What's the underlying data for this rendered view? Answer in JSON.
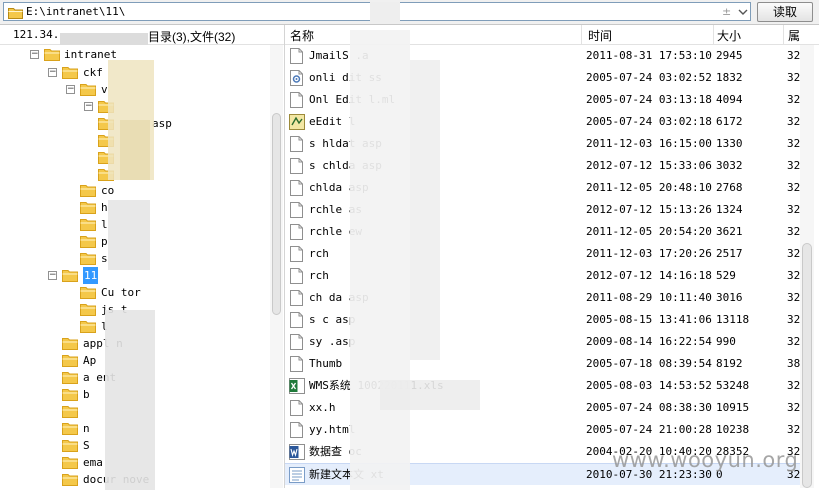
{
  "toolbar": {
    "path_value": "E:\\intranet\\11\\",
    "read_button": "读取",
    "combo_icon": "down-chevron-icon"
  },
  "tree": {
    "ip_prefix": "121.34.",
    "counts": "目录(3),文件(32)",
    "items": [
      {
        "label": "intranet",
        "expanded": true
      },
      {
        "label": "ckf",
        "expanded": true
      },
      {
        "label": "v",
        "expanded": true
      },
      {
        "label": "",
        "expanded": true
      },
      {
        "label": "asp"
      },
      {
        "label": ""
      },
      {
        "label": ""
      },
      {
        "label": ""
      },
      {
        "label": "co"
      },
      {
        "label": "he"
      },
      {
        "label": "la"
      },
      {
        "label": "pl"
      },
      {
        "label": "sk"
      },
      {
        "label": "11",
        "expanded": true,
        "selected": true
      },
      {
        "label": "Cu        tor"
      },
      {
        "label": "js      t"
      },
      {
        "label": "l"
      },
      {
        "label": "appl      n"
      },
      {
        "label": "Ap"
      },
      {
        "label": "a        ent"
      },
      {
        "label": "b"
      },
      {
        "label": ""
      },
      {
        "label": "n"
      },
      {
        "label": "S"
      },
      {
        "label": "ema"
      },
      {
        "label": "docur    nove"
      }
    ]
  },
  "list": {
    "headers": {
      "name": "名称",
      "time": "时间",
      "size": "大小",
      "attr": "属"
    },
    "files": [
      {
        "name": "JmailS    .a",
        "icon": "file-icon",
        "time": "2011-08-31 17:53:10",
        "size": "2945",
        "attr": "32"
      },
      {
        "name": "onli  dit     ss",
        "icon": "gear-file-icon",
        "time": "2005-07-24 03:02:52",
        "size": "1832",
        "attr": "32"
      },
      {
        "name": "Onl   Edit    l.ml",
        "icon": "file-icon",
        "time": "2005-07-24 03:13:18",
        "size": "4094",
        "attr": "32"
      },
      {
        "name": "    eEdit    l",
        "icon": "script-file-icon",
        "time": "2005-07-24 03:02:18",
        "size": "6172",
        "attr": "32"
      },
      {
        "name": "s   hldat    asp",
        "icon": "file-icon",
        "time": "2011-12-03 16:15:00",
        "size": "1330",
        "attr": "32"
      },
      {
        "name": "s   chlda    asp",
        "icon": "file-icon",
        "time": "2012-07-12 15:33:06",
        "size": "3032",
        "attr": "32"
      },
      {
        "name": "    chlda    asp",
        "icon": "file-icon",
        "time": "2011-12-05 20:48:10",
        "size": "2768",
        "attr": "32"
      },
      {
        "name": "   rchle     as",
        "icon": "file-icon",
        "time": "2012-07-12 15:13:26",
        "size": "1324",
        "attr": "32"
      },
      {
        "name": "   rchle     ew",
        "icon": "file-icon",
        "time": "2011-12-05 20:54:20",
        "size": "3621",
        "attr": "32"
      },
      {
        "name": "   rch",
        "icon": "file-icon",
        "time": "2011-12-03 17:20:26",
        "size": "2517",
        "attr": "32"
      },
      {
        "name": "   rch",
        "icon": "file-icon",
        "time": "2012-07-12 14:16:18",
        "size": "529",
        "attr": "32"
      },
      {
        "name": "    ch       da  asp",
        "icon": "file-icon",
        "time": "2011-08-29 10:11:40",
        "size": "3016",
        "attr": "32"
      },
      {
        "name": "s   c        asp",
        "icon": "file-icon",
        "time": "2005-08-15 13:41:06",
        "size": "13118",
        "attr": "32"
      },
      {
        "name": "sy         .asp",
        "icon": "file-icon",
        "time": "2009-08-14 16:22:54",
        "size": "990",
        "attr": "32"
      },
      {
        "name": "Thumb",
        "icon": "file-icon",
        "time": "2005-07-18 08:39:54",
        "size": "8192",
        "attr": "38"
      },
      {
        "name": "WMS系统             100220111.xls",
        "icon": "excel-file-icon",
        "time": "2005-08-03 14:53:52",
        "size": "53248",
        "attr": "32"
      },
      {
        "name": "xx.h",
        "icon": "file-icon",
        "time": "2005-07-24 08:38:30",
        "size": "10915",
        "attr": "32"
      },
      {
        "name": "yy.html",
        "icon": "file-icon",
        "time": "2005-07-24 21:00:28",
        "size": "10238",
        "attr": "32"
      },
      {
        "name": "数据查         oc",
        "icon": "word-file-icon",
        "time": "2004-02-20 10:40:20",
        "size": "28352",
        "attr": "32"
      },
      {
        "name": "新建文本文      xt",
        "icon": "text-file-icon",
        "time": "2010-07-30 21:23:30",
        "size": "0",
        "attr": "32",
        "selected": true
      }
    ]
  },
  "watermark": "www.wooyun.org",
  "colors": {
    "folder": "#f4c84a",
    "folder_dark": "#d9a21b",
    "selection": "#3399ff",
    "row_selected": "#e5eefc"
  }
}
